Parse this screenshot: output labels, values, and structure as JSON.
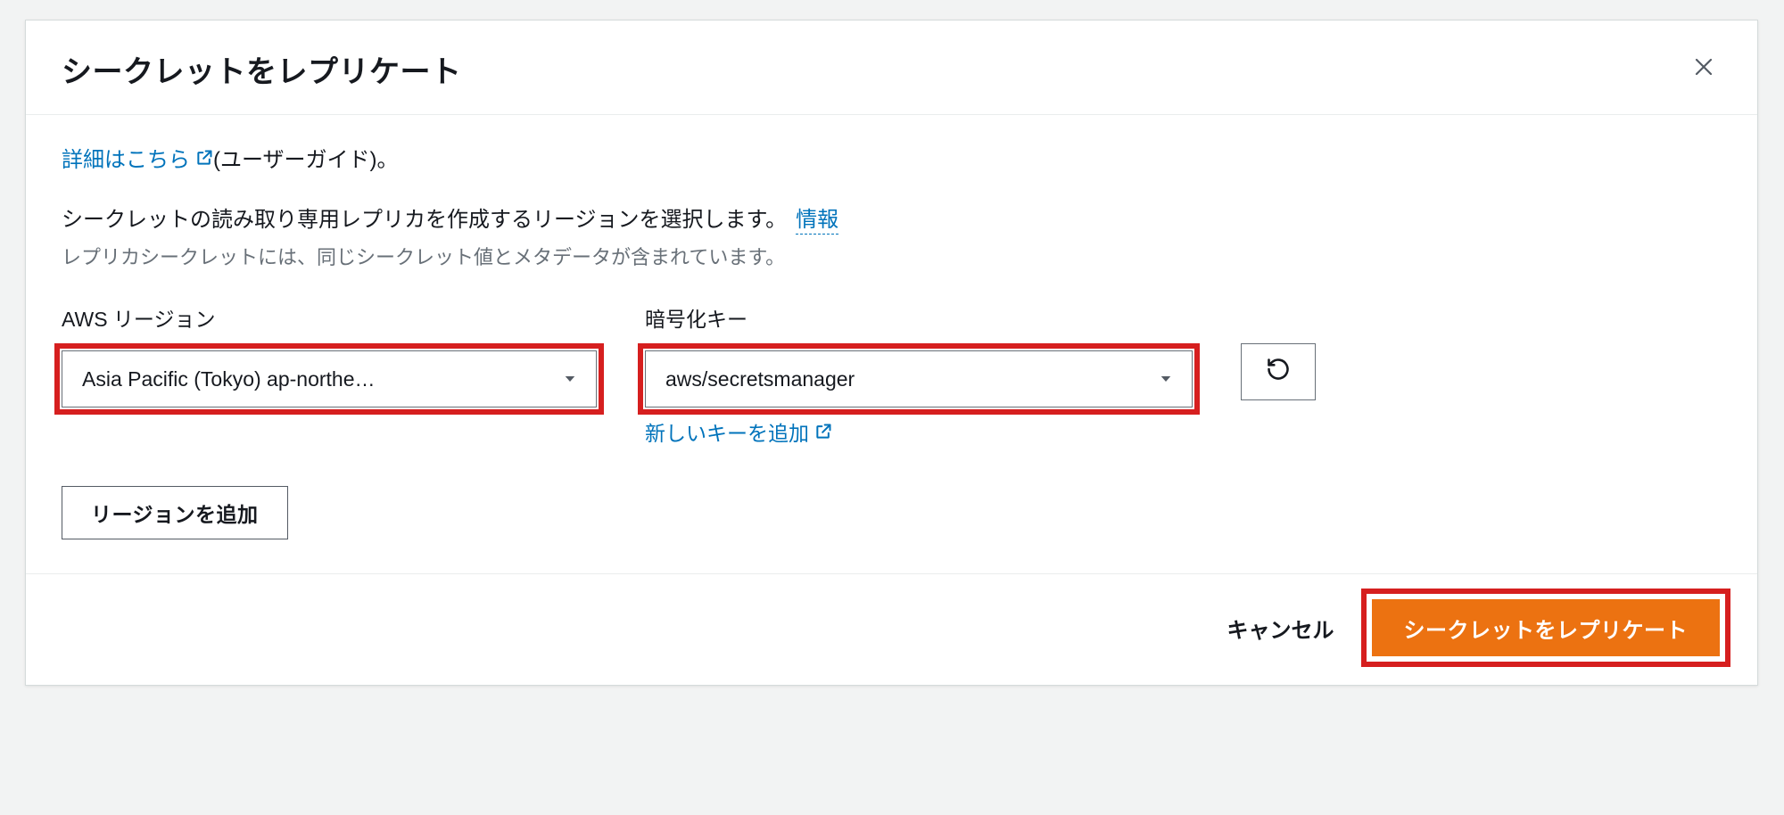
{
  "modal": {
    "title": "シークレットをレプリケート",
    "learn_more_link": "詳細はこちら",
    "learn_more_suffix": " (ユーザーガイド)。",
    "instruction": "シークレットの読み取り専用レプリカを作成するリージョンを選択します。",
    "info_link": "情報",
    "sub_instruction": "レプリカシークレットには、同じシークレット値とメタデータが含まれています。",
    "region_label": "AWS リージョン",
    "region_value": "Asia Pacific (Tokyo) ap-northe…",
    "key_label": "暗号化キー",
    "key_value": "aws/secretsmanager",
    "add_new_key": "新しいキーを追加",
    "add_region_btn": "リージョンを追加",
    "cancel": "キャンセル",
    "submit": "シークレットをレプリケート"
  }
}
